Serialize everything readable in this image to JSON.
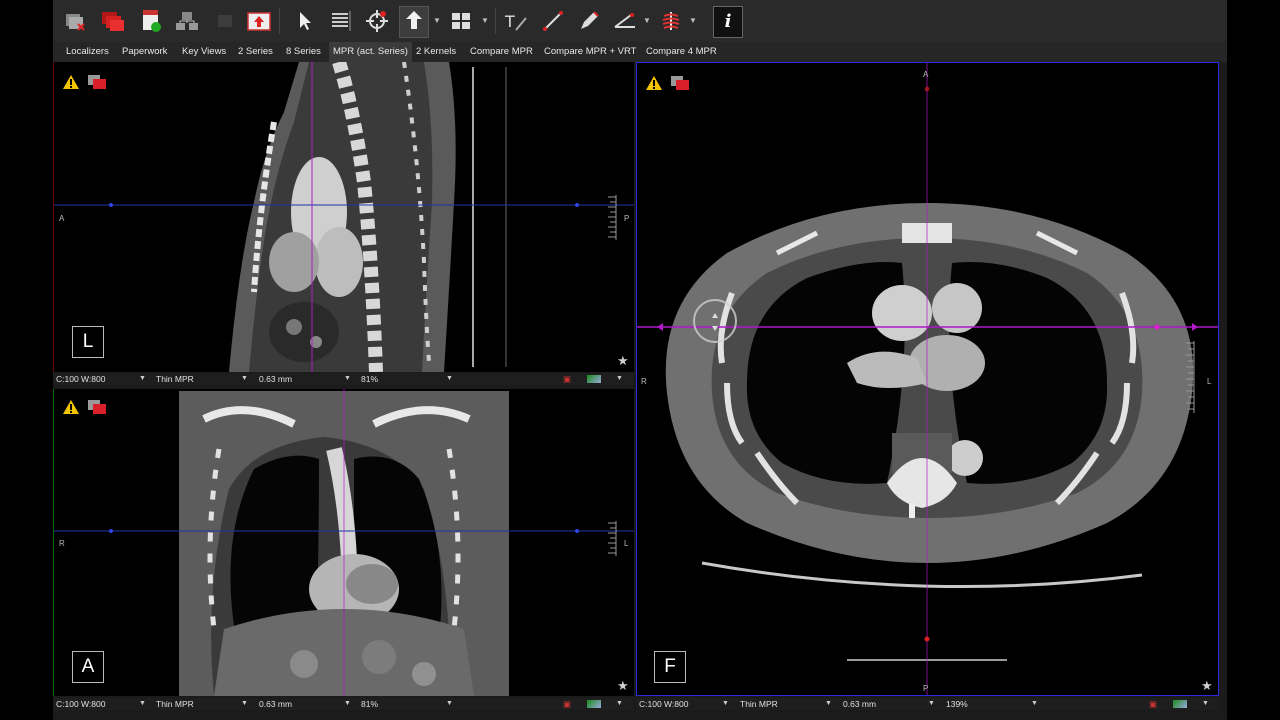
{
  "tabs": [
    "Localizers",
    "Paperwork",
    "Key Views",
    "2 Series",
    "8 Series",
    "MPR (act. Series)",
    "2 Kernels",
    "Compare MPR",
    "Compare MPR + VRT",
    "Compare 4 MPR"
  ],
  "active_tab_index": 5,
  "toolbar": {
    "info_label": "i"
  },
  "viewports": {
    "sagittal": {
      "orientation": "L",
      "labels": {
        "left": "A",
        "right": "P"
      },
      "status": {
        "window": "C:100 W:800",
        "mode": "Thin MPR",
        "thickness": "0.63 mm",
        "zoom": "81%"
      }
    },
    "coronal": {
      "orientation": "A",
      "labels": {
        "left": "R",
        "right": "L"
      },
      "status": {
        "window": "C:100 W:800",
        "mode": "Thin MPR",
        "thickness": "0.63 mm",
        "zoom": "81%"
      }
    },
    "axial": {
      "orientation": "F",
      "labels": {
        "top": "A",
        "bottom": "P",
        "left": "R",
        "right": "L"
      },
      "status": {
        "window": "C:100 W:800",
        "mode": "Thin MPR",
        "thickness": "0.63 mm",
        "zoom": "139%"
      }
    }
  },
  "colors": {
    "crosshair_magenta": "#b018c8",
    "crosshair_blue": "#2233aa",
    "active_border": "#2a2ae0",
    "warning_yellow": "#f5c400",
    "stack_red": "#d9202a"
  }
}
